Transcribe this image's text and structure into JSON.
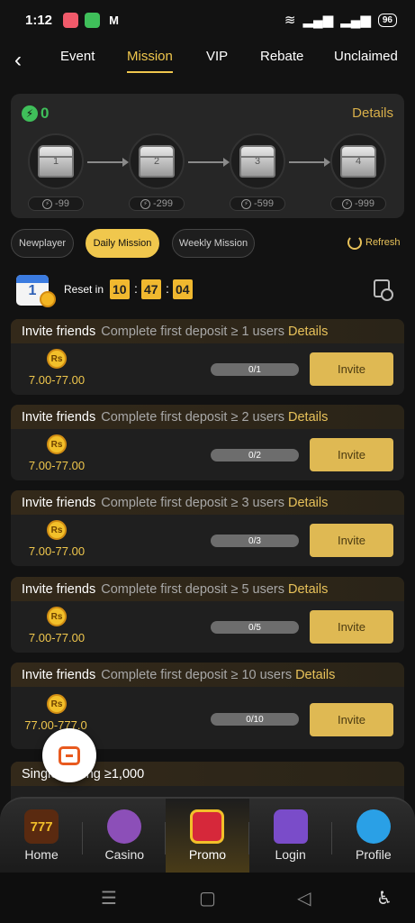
{
  "status": {
    "time": "1:12",
    "battery": "96"
  },
  "nav_tabs": [
    "Event",
    "Mission",
    "VIP",
    "Rebate",
    "Unclaimed"
  ],
  "active_tab": "Mission",
  "energy": {
    "count": "0",
    "details": "Details"
  },
  "chests": [
    {
      "num": "1",
      "cost": "-99"
    },
    {
      "num": "2",
      "cost": "-299"
    },
    {
      "num": "3",
      "cost": "-599"
    },
    {
      "num": "4",
      "cost": "-999"
    }
  ],
  "subtabs": [
    "Newplayer",
    "Daily Mission",
    "Weekly Mission"
  ],
  "active_subtab": "Daily Mission",
  "refresh_label": "Refresh",
  "reset": {
    "label": "Reset in",
    "h": "10",
    "m": "47",
    "s": "04",
    "calendar_day": "1"
  },
  "missions": [
    {
      "title": "Invite friends",
      "condition": "Complete first deposit ≥ 1 users",
      "details": "Details",
      "coin": "Rs",
      "reward": "7.00-77.00",
      "progress": "0/1",
      "progress_ratio": 0,
      "button": "Invite"
    },
    {
      "title": "Invite friends",
      "condition": "Complete first deposit ≥ 2 users",
      "details": "Details",
      "coin": "Rs",
      "reward": "7.00-77.00",
      "progress": "0/2",
      "progress_ratio": 0,
      "button": "Invite"
    },
    {
      "title": "Invite friends",
      "condition": "Complete first deposit ≥ 3 users",
      "details": "Details",
      "coin": "Rs",
      "reward": "7.00-77.00",
      "progress": "0/3",
      "progress_ratio": 0,
      "button": "Invite"
    },
    {
      "title": "Invite friends",
      "condition": "Complete first deposit ≥ 5 users",
      "details": "Details",
      "coin": "Rs",
      "reward": "7.00-77.00",
      "progress": "0/5",
      "progress_ratio": 0,
      "button": "Invite"
    },
    {
      "title": "Invite friends",
      "condition": "Complete first deposit ≥ 10 users",
      "details": "Details",
      "coin": "Rs",
      "reward": "77.00-777.0",
      "progress": "0/10",
      "progress_ratio": 0,
      "button": "Invite"
    }
  ],
  "partial_mission": {
    "title": "Single betting ≥1,000"
  },
  "bottom_nav": [
    {
      "label": "Home",
      "icon": "slot-777-icon"
    },
    {
      "label": "Casino",
      "icon": "casino-girl-icon"
    },
    {
      "label": "Promo",
      "icon": "gift-box-icon"
    },
    {
      "label": "Login",
      "icon": "padlock-icon"
    },
    {
      "label": "Profile",
      "icon": "profile-avatar-icon"
    }
  ],
  "active_bottom": "Promo",
  "colors": {
    "accent": "#f0c74d",
    "energy": "#3fbf5a",
    "background": "#121212"
  }
}
